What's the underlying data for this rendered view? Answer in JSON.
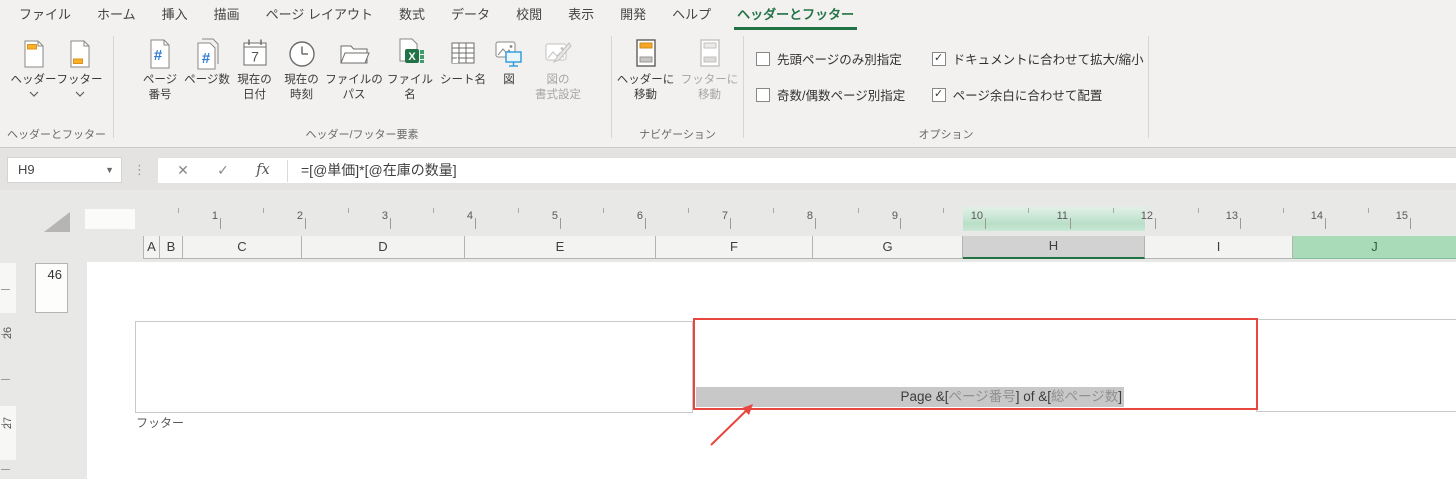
{
  "tabs": [
    {
      "id": "file",
      "label": "ファイル",
      "active": false
    },
    {
      "id": "home",
      "label": "ホーム",
      "active": false
    },
    {
      "id": "insert",
      "label": "挿入",
      "active": false
    },
    {
      "id": "draw",
      "label": "描画",
      "active": false
    },
    {
      "id": "page-layout",
      "label": "ページ レイアウト",
      "active": false
    },
    {
      "id": "formulas",
      "label": "数式",
      "active": false
    },
    {
      "id": "data",
      "label": "データ",
      "active": false
    },
    {
      "id": "review",
      "label": "校閲",
      "active": false
    },
    {
      "id": "view",
      "label": "表示",
      "active": false
    },
    {
      "id": "developer",
      "label": "開発",
      "active": false
    },
    {
      "id": "help",
      "label": "ヘルプ",
      "active": false
    },
    {
      "id": "header-footer",
      "label": "ヘッダーとフッター",
      "active": true
    }
  ],
  "ribbon": {
    "groups": [
      {
        "label": "ヘッダーとフッター",
        "buttons": [
          {
            "id": "header",
            "icon": "header-icon",
            "label": "ヘッダー",
            "dropdown": true,
            "disabled": false
          },
          {
            "id": "footer",
            "icon": "footer-icon",
            "label": "フッター",
            "dropdown": true,
            "disabled": false
          }
        ]
      },
      {
        "label": "ヘッダー/フッター要素",
        "buttons": [
          {
            "id": "page-number",
            "icon": "page-number-icon",
            "label": "ページ\n番号",
            "disabled": false
          },
          {
            "id": "page-count",
            "icon": "page-count-icon",
            "label": "ページ数",
            "disabled": false
          },
          {
            "id": "current-date",
            "icon": "current-date-icon",
            "label": "現在の\n日付",
            "disabled": false
          },
          {
            "id": "current-time",
            "icon": "current-time-icon",
            "label": "現在の\n時刻",
            "disabled": false
          },
          {
            "id": "file-path",
            "icon": "file-path-icon",
            "label": "ファイルの\nパス",
            "disabled": false
          },
          {
            "id": "file-name",
            "icon": "file-name-icon",
            "label": "ファイル名",
            "disabled": false
          },
          {
            "id": "sheet-name",
            "icon": "sheet-name-icon",
            "label": "シート名",
            "disabled": false
          },
          {
            "id": "picture",
            "icon": "picture-icon",
            "label": "図",
            "disabled": false
          },
          {
            "id": "picture-format",
            "icon": "picture-format-icon",
            "label": "図の\n書式設定",
            "disabled": true
          }
        ]
      },
      {
        "label": "ナビゲーション",
        "buttons": [
          {
            "id": "go-header",
            "icon": "go-header-icon",
            "label": "ヘッダーに\n移動",
            "disabled": false
          },
          {
            "id": "go-footer",
            "icon": "go-footer-icon",
            "label": "フッターに\n移動",
            "disabled": true
          }
        ]
      },
      {
        "label": "オプション",
        "checkboxes": [
          {
            "id": "first-page",
            "label": "先頭ページのみ別指定",
            "checked": false
          },
          {
            "id": "odd-even",
            "label": "奇数/偶数ページ別指定",
            "checked": false
          },
          {
            "id": "scale-with-doc",
            "label": "ドキュメントに合わせて拡大/縮小",
            "checked": true
          },
          {
            "id": "align-margins",
            "label": "ページ余白に合わせて配置",
            "checked": true
          }
        ]
      }
    ]
  },
  "formula_bar": {
    "name_box": "H9",
    "cancel_glyph": "✕",
    "enter_glyph": "✓",
    "fx_label": "fx",
    "formula": "=[@単価]*[@在庫の数量]"
  },
  "sheet": {
    "ruler_numbers": [
      "1",
      "2",
      "3",
      "4",
      "5",
      "6",
      "7",
      "8",
      "9",
      "10",
      "11",
      "12",
      "13",
      "14",
      "15"
    ],
    "ruler_selected_units": "10-12",
    "columns": [
      {
        "label": "A",
        "state": "normal"
      },
      {
        "label": "B",
        "state": "normal"
      },
      {
        "label": "C",
        "state": "normal"
      },
      {
        "label": "D",
        "state": "normal"
      },
      {
        "label": "E",
        "state": "normal"
      },
      {
        "label": "F",
        "state": "normal"
      },
      {
        "label": "G",
        "state": "normal"
      },
      {
        "label": "H",
        "state": "selected"
      },
      {
        "label": "I",
        "state": "normal"
      },
      {
        "label": "J",
        "state": "highlighted"
      }
    ],
    "vertical_ruler_numbers": [
      "26",
      "27"
    ],
    "row_header": "46",
    "footer_label": "フッター",
    "footer_code_segments": [
      {
        "text": "Page &[",
        "muted": false
      },
      {
        "text": "ページ番号",
        "muted": true
      },
      {
        "text": "] of &[",
        "muted": false
      },
      {
        "text": "総ページ数",
        "muted": true
      },
      {
        "text": "]",
        "muted": false
      }
    ]
  },
  "colors": {
    "accent_green": "#217346",
    "annotation_red": "#e8473f",
    "selected_column_bg": "#d2d2d2",
    "highlighted_column_bg": "#a9dbb9",
    "selection_strip_gray": "#c8c8c8",
    "muted_field_text": "#909090"
  }
}
